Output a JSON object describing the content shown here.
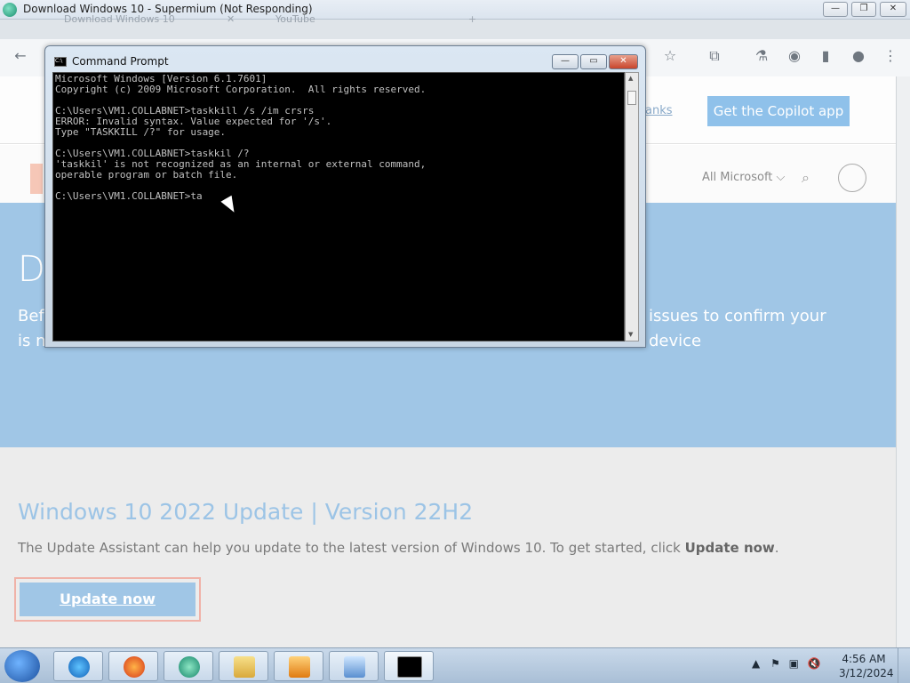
{
  "browser": {
    "window_title": "Download Windows 10 - Supermium (Not Responding)",
    "tabs": [
      {
        "label": "Download Windows 10"
      },
      {
        "label": "YouTube"
      }
    ],
    "controls": {
      "minimize": "—",
      "restore": "❐",
      "close": "✕"
    },
    "toolbar_icons": [
      "back-icon",
      "star-icon",
      "extensions-icon",
      "flask-icon",
      "ad-icon",
      "sidebar-icon",
      "profile-icon",
      "menu-icon"
    ]
  },
  "page": {
    "promo_link": "anks",
    "copilot_button": "Get the Copilot app",
    "all_microsoft": "All Microsoft ⌵",
    "hero_title_partial": "Do",
    "hero_desc_left": "Befo",
    "hero_desc_right": "issues to confirm your device",
    "hero_desc_line2": "is n",
    "update_heading": "Windows 10 2022 Update | Version 22H2",
    "update_desc_prefix": "The Update Assistant can help you update to the latest version of Windows 10. To get started, click ",
    "update_desc_bold": "Update now",
    "update_desc_suffix": ".",
    "update_button": "Update now"
  },
  "cmd": {
    "title": "Command Prompt",
    "icon_text": "C:\\",
    "lines": [
      "Microsoft Windows [Version 6.1.7601]",
      "Copyright (c) 2009 Microsoft Corporation.  All rights reserved.",
      "",
      "C:\\Users\\VM1.COLLABNET>taskkill /s /im crsrs",
      "ERROR: Invalid syntax. Value expected for '/s'.",
      "Type \"TASKKILL /?\" for usage.",
      "",
      "C:\\Users\\VM1.COLLABNET>taskkil /?",
      "'taskkil' is not recognized as an internal or external command,",
      "operable program or batch file.",
      "",
      "C:\\Users\\VM1.COLLABNET>ta"
    ]
  },
  "taskbar": {
    "items": [
      "internet-explorer",
      "firefox",
      "supermium",
      "file-explorer",
      "media-player",
      "control-panel",
      "command-prompt"
    ],
    "time": "4:56 AM",
    "date": "3/12/2024"
  }
}
